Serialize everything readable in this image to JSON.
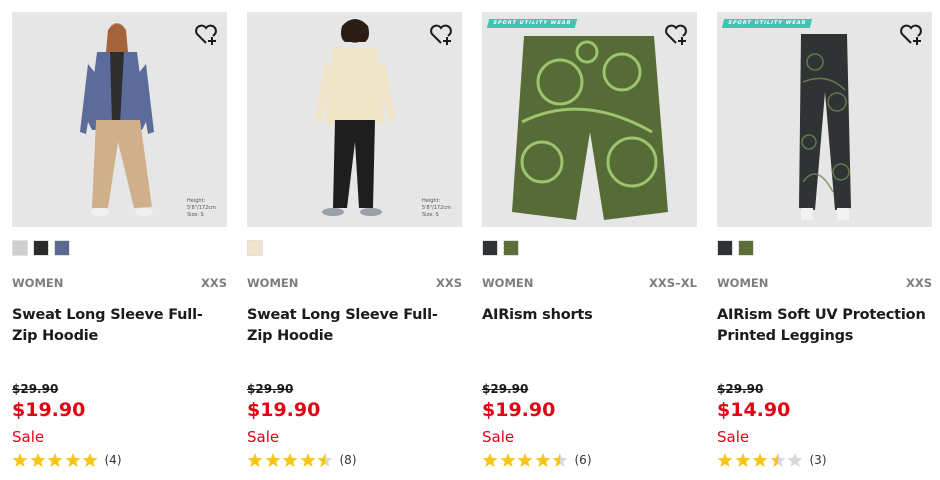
{
  "colors": {
    "sale_red": "#e60014",
    "star_gold": "#f5c518",
    "star_empty": "#d8d8d8",
    "badge_teal": "#3dc7b2"
  },
  "products": [
    {
      "gender": "WOMEN",
      "size": "XXS",
      "name": "Sweat Long Sleeve Full-Zip Hoodie",
      "old_price": "$29.90",
      "price": "$19.90",
      "sale": "Sale",
      "rating": 5,
      "review_count": "(4)",
      "swatches": [
        "#cfcfcf",
        "#2a2a2a",
        "#5c6a91"
      ],
      "model_info": [
        "Height: 5'8\"/172cm",
        "Size: S"
      ],
      "badge": ""
    },
    {
      "gender": "WOMEN",
      "size": "XXS",
      "name": "Sweat Long Sleeve Full-Zip Hoodie",
      "old_price": "$29.90",
      "price": "$19.90",
      "sale": "Sale",
      "rating": 4.5,
      "review_count": "(8)",
      "swatches": [
        "#f1e4cc"
      ],
      "model_info": [
        "Height: 5'8\"/172cm",
        "Size: S"
      ],
      "badge": ""
    },
    {
      "gender": "WOMEN",
      "size": "XXS–XL",
      "name": "AIRism shorts",
      "old_price": "$29.90",
      "price": "$19.90",
      "sale": "Sale",
      "rating": 4.5,
      "review_count": "(6)",
      "swatches": [
        "#2d3236",
        "#5d6e3a"
      ],
      "model_info": [],
      "badge": "SPORT UTILITY WEAR"
    },
    {
      "gender": "WOMEN",
      "size": "XXS",
      "name": "AIRism Soft UV Protection Printed Leggings",
      "old_price": "$29.90",
      "price": "$14.90",
      "sale": "Sale",
      "rating": 3.5,
      "review_count": "(3)",
      "swatches": [
        "#2d3236",
        "#5d6e3a"
      ],
      "model_info": [],
      "badge": "SPORT UTILITY WEAR"
    }
  ]
}
